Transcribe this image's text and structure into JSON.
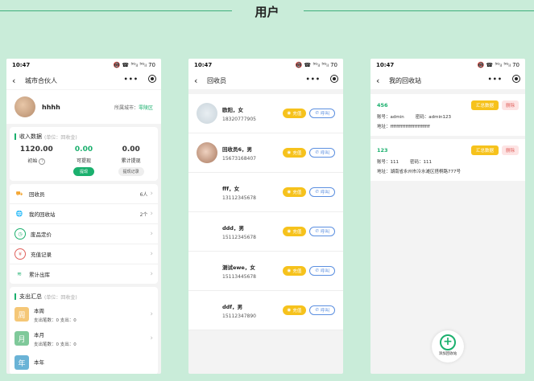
{
  "page": {
    "title": "用户"
  },
  "status": {
    "time": "10:47",
    "icons": "📵 ☎ ⁵ᴳᵢₗ ⁵ᴳᵢₗ",
    "battery": "70"
  },
  "phone1": {
    "nav_title": "城市合伙人",
    "profile": {
      "name": "hhhh",
      "city_label": "所属城市：",
      "city": "零陵区"
    },
    "income": {
      "title": "收入数据",
      "unit": "(单位：回收金)",
      "cols": [
        {
          "value": "1120.00",
          "label": "初始",
          "help": "?"
        },
        {
          "value": "0.00",
          "label": "可提现",
          "button": "提现"
        },
        {
          "value": "0.00",
          "label": "累计提现",
          "button": "提现记录"
        }
      ]
    },
    "menu": [
      {
        "label": "回收员",
        "count": "6人",
        "icon": "recycler-icon"
      },
      {
        "label": "我的回收站",
        "count": "2个",
        "icon": "globe-icon"
      },
      {
        "label": "废品定价",
        "icon": "price-icon"
      },
      {
        "label": "充值记录",
        "icon": "yen-icon"
      },
      {
        "label": "累计出库",
        "icon": "stack-icon"
      }
    ],
    "expense": {
      "title": "支出汇总",
      "unit": "(单位：回收金)",
      "items": [
        {
          "badge": "周",
          "title": "本周",
          "sub": "支出笔数：0      支出：0",
          "color": "#f5c777"
        },
        {
          "badge": "月",
          "title": "本月",
          "sub": "支出笔数：0      支出：0",
          "color": "#7fc99a"
        },
        {
          "badge": "年",
          "title": "本年",
          "sub": "",
          "color": "#6ab3d6"
        }
      ]
    }
  },
  "phone2": {
    "nav_title": "回收员",
    "charge_label": "充值",
    "call_label": "呼叫",
    "recyclers": [
      {
        "name": "欧阳，女",
        "phone": "18320777905",
        "avatar": "p1img"
      },
      {
        "name": "回收员6，男",
        "phone": "15673168407",
        "avatar": "p2img"
      },
      {
        "name": "fff，女",
        "phone": "13112345678",
        "avatar": "empty"
      },
      {
        "name": "ddd，男",
        "phone": "15112345678",
        "avatar": "empty"
      },
      {
        "name": "测试ewe，女",
        "phone": "15113445678",
        "avatar": "empty"
      },
      {
        "name": "ddf，男",
        "phone": "15112347890",
        "avatar": "empty"
      }
    ]
  },
  "phone3": {
    "nav_title": "我的回收站",
    "sum_label": "汇总数据",
    "del_label": "删除",
    "stations": [
      {
        "id": "456",
        "account": "账号：admin",
        "password": "密码：admin123",
        "address": "地址：ffffffffffffffffffffffffff"
      },
      {
        "id": "123",
        "account": "账号：111",
        "password": "密码：111",
        "address": "地址：湖南省永州市冷水滩区搭桐路777号"
      }
    ],
    "add_label": "添加回收站"
  },
  "colors": {
    "background": "#c9ecd9",
    "accent": "#1bb06e",
    "yellow": "#f6c21c",
    "blue": "#5b8fe0"
  }
}
